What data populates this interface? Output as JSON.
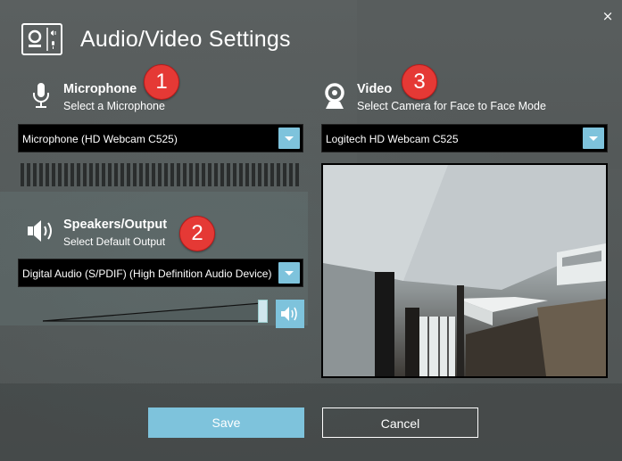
{
  "dialog": {
    "title": "Audio/Video Settings",
    "close_symbol": "×"
  },
  "microphone": {
    "title": "Microphone",
    "subtitle": "Select a Microphone",
    "badge": "1",
    "selected": "Microphone (HD Webcam C525)",
    "level_bars": 45
  },
  "speakers": {
    "title": "Speakers/Output",
    "subtitle": "Select Default Output",
    "badge": "2",
    "selected": "Digital Audio (S/PDIF) (High Definition Audio Device)",
    "volume_fraction": 0.97
  },
  "video": {
    "title": "Video",
    "subtitle": "Select Camera for Face to Face Mode",
    "badge": "3",
    "selected": "Logitech HD Webcam C525"
  },
  "buttons": {
    "save": "Save",
    "cancel": "Cancel"
  },
  "colors": {
    "accent": "#7ec3dc",
    "badge": "#e53935"
  },
  "icons": {
    "header": "camera-settings-icon",
    "microphone": "microphone-icon",
    "speakers": "speaker-icon",
    "video": "webcam-icon",
    "volume": "volume-icon",
    "close": "close-icon"
  }
}
